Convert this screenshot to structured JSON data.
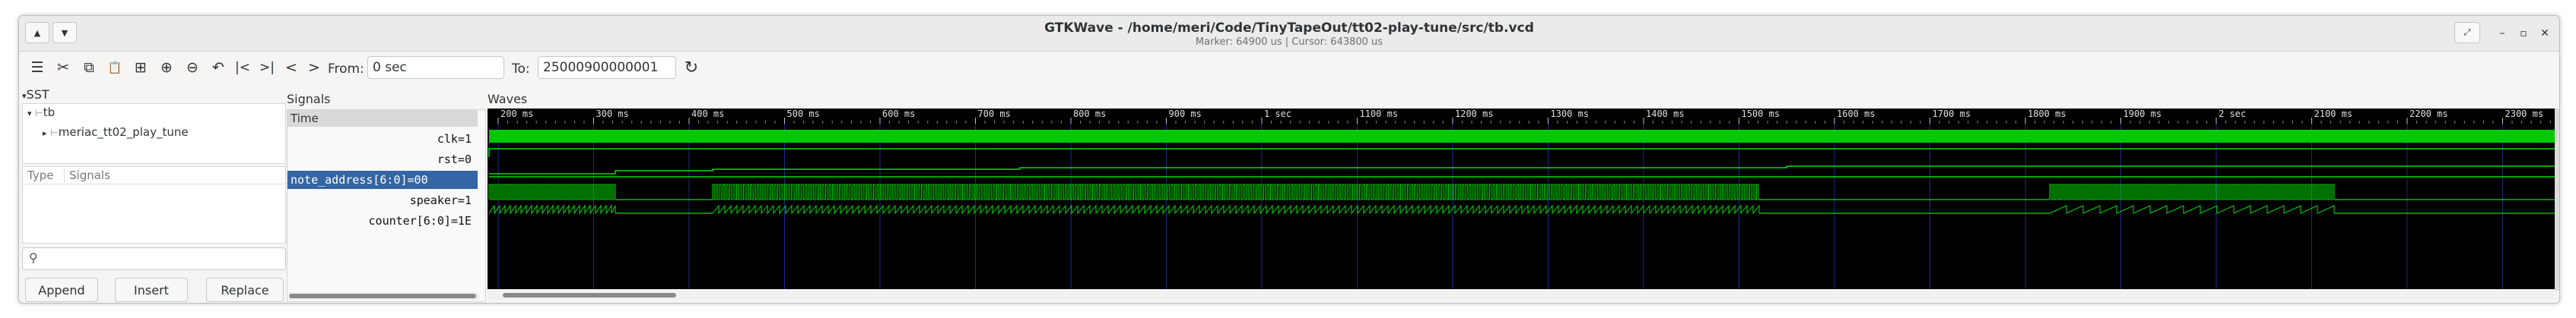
{
  "window": {
    "title": "GTKWave - /home/meri/Code/TinyTapeOut/tt02-play-tune/src/tb.vcd",
    "subtitle": "Marker: 64900 us  |  Cursor: 643800 us",
    "shade_up": "▲",
    "shade_down": "▼",
    "expand_icon": "⤢",
    "minimize": "–",
    "maximize": "▫",
    "close": "✕"
  },
  "toolbar": {
    "from_label": "From:",
    "from_value": "0 sec",
    "to_label": "To:",
    "to_value": "25000900000001",
    "icons": [
      "menu-icon",
      "cut-icon",
      "copy-icon",
      "paste-icon",
      "zoom-fit-icon",
      "zoom-in-icon",
      "zoom-out-icon",
      "undo-icon",
      "first-icon",
      "last-icon",
      "prev-icon",
      "next-icon"
    ],
    "glyphs": [
      "☰",
      "✂",
      "⧉",
      "📋",
      "⊞",
      "⊕",
      "⊖",
      "↶",
      "|<",
      ">|",
      "<",
      ">"
    ],
    "reload_glyph": "↻"
  },
  "sst": {
    "title": "SST",
    "root": "tb",
    "child": "meriac_tt02_play_tune",
    "type_col": "Type",
    "signals_col": "Signals",
    "search_glyph": "⚲"
  },
  "buttons": {
    "append": "Append",
    "insert": "Insert",
    "replace": "Replace"
  },
  "signals": {
    "title": "Signals",
    "time_header": "Time",
    "rows": [
      "clk=1",
      "rst=0",
      "note_address[6:0]=00",
      "speaker=1",
      "counter[6:0]=1E"
    ],
    "selected_index": 2
  },
  "waves": {
    "title": "Waves",
    "time_ticks": [
      "200 ms",
      "300 ms",
      "400 ms",
      "500 ms",
      "600 ms",
      "700 ms",
      "800 ms",
      "900 ms",
      "1 sec",
      "1100 ms",
      "1200 ms",
      "1300 ms",
      "1400 ms",
      "1500 ms",
      "1600 ms",
      "1700 ms",
      "1800 ms",
      "1900 ms",
      "2 sec",
      "2100 ms",
      "2200 ms",
      "2300 ms"
    ],
    "trace_color": "#00e000",
    "grid_color": "#1a2d8a",
    "background": "#000000"
  }
}
